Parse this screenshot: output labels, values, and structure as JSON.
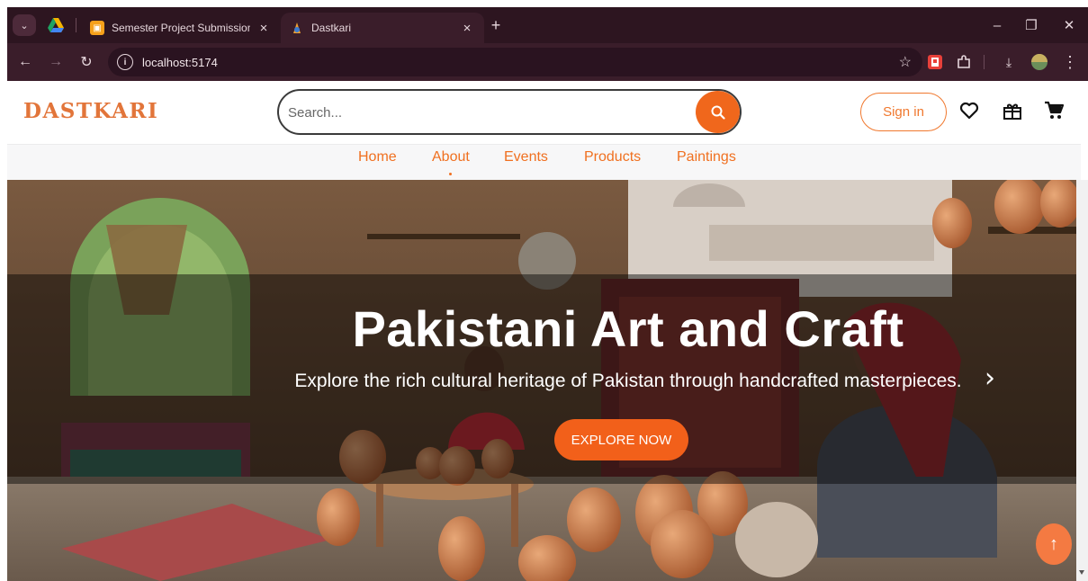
{
  "browser": {
    "tabs": [
      {
        "title": "Semester Project Submission (L",
        "icon": "slides-icon"
      },
      {
        "title": "Dastkari",
        "icon": "dastkari-favicon"
      }
    ],
    "active_tab": 1,
    "url": "localhost:5174",
    "colors": {
      "frame": "#2d1520",
      "toolbar": "#3a1d2a",
      "omnibox": "#2a1320"
    }
  },
  "site": {
    "logo": "DASTKARI",
    "search": {
      "placeholder": "Search...",
      "value": ""
    },
    "signin_label": "Sign in",
    "header_icons": [
      "heart-icon",
      "gift-icon",
      "cart-icon"
    ],
    "nav": [
      {
        "label": "Home",
        "active": false
      },
      {
        "label": "About",
        "active": true
      },
      {
        "label": "Events",
        "active": false
      },
      {
        "label": "Products",
        "active": false
      },
      {
        "label": "Paintings",
        "active": false
      }
    ],
    "colors": {
      "accent": "#f0671c",
      "logo": "#e2753a"
    }
  },
  "hero": {
    "title": "Pakistani Art and Craft",
    "subtitle": "Explore the rich cultural heritage of Pakistan through handcrafted masterpieces.",
    "cta_label": "EXPLORE NOW",
    "next_icon": "chevron-right-icon"
  },
  "scroll_top_icon": "arrow-up-icon",
  "glyphs": {
    "menu": "⌄",
    "close": "×",
    "new_tab": "+",
    "minimize": "–",
    "restore": "❐",
    "win_close": "✕",
    "back": "←",
    "forward": "→",
    "reload": "↻",
    "info": "i",
    "star": "☆",
    "download": "⤓",
    "more": "⋮",
    "chevron": "›",
    "arrow_up": "↑"
  }
}
